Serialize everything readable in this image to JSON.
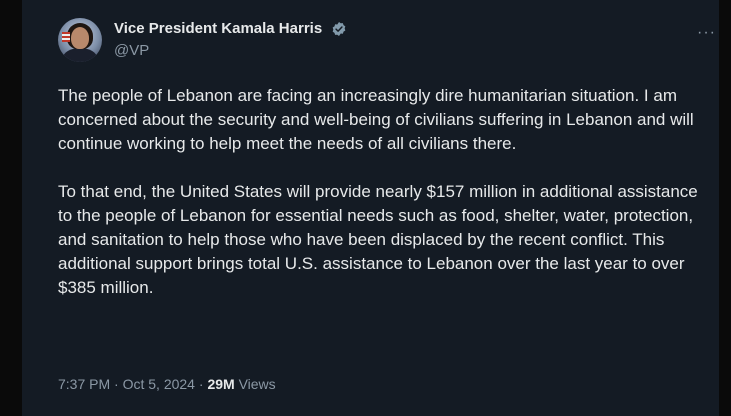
{
  "tweet": {
    "display_name": "Vice President Kamala Harris",
    "handle": "@VP",
    "more_label": "···",
    "paragraphs": [
      "The people of Lebanon are facing an increasingly dire humanitarian situation. I am concerned about the security and well-being of civilians suffering in Lebanon and will continue working to help meet the needs of all civilians there.",
      "To that end, the United States will provide nearly $157 million in additional assistance to the people of Lebanon for essential needs such as food, shelter, water, protection, and sanitation to help those who have been displaced by the recent conflict. This additional support brings total U.S. assistance to Lebanon over the last year to over $385 million."
    ],
    "time": "7:37 PM",
    "separator": "·",
    "date": "Oct 5, 2024",
    "views_count": "29M",
    "views_label": "Views"
  },
  "icons": {
    "verified": "verified-badge-icon",
    "more": "more-options-icon"
  },
  "colors": {
    "background": "#141b24",
    "primary_text": "#e7e9ea",
    "secondary_text": "#8b98a5",
    "verified_badge": "#829aab"
  }
}
